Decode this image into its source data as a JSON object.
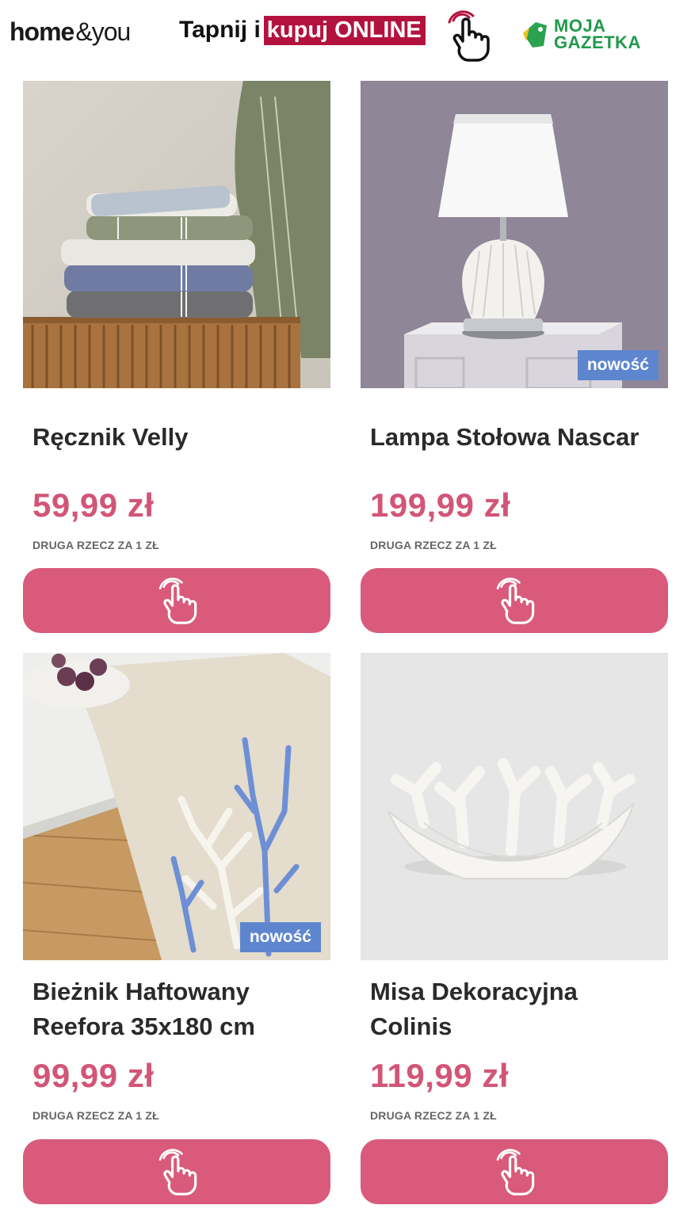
{
  "header": {
    "brand_word1": "home",
    "brand_amp": "&",
    "brand_word2": "you",
    "promo_prefix": "Tapnij i",
    "promo_highlight": "kupuj ONLINE",
    "partner_line1": "MOJA",
    "partner_line2": "GAZETKA"
  },
  "colors": {
    "price": "#d25577",
    "button": "#d95a7a",
    "badge": "#5e86cf",
    "promo_highlight": "#b4123e",
    "partner_green": "#1f9a4a"
  },
  "products": [
    {
      "title": "Ręcznik Velly",
      "price": "59,99 zł",
      "note": "DRUGA RZECZ ZA 1 ZŁ",
      "badge": "",
      "icon": "hand-tap-icon"
    },
    {
      "title": "Lampa Stołowa Nascar",
      "price": "199,99 zł",
      "note": "DRUGA RZECZ ZA 1 ZŁ",
      "badge": "nowość",
      "icon": "hand-tap-icon"
    },
    {
      "title": "Bieżnik Haftowany Reefora 35x180 cm",
      "price": "99,99 zł",
      "note": "DRUGA RZECZ ZA 1 ZŁ",
      "badge": "nowość",
      "icon": "hand-tap-icon"
    },
    {
      "title": "Misa Dekoracyjna Colinis",
      "price": "119,99 zł",
      "note": "DRUGA RZECZ ZA 1 ZŁ",
      "badge": "",
      "icon": "hand-tap-icon"
    }
  ]
}
